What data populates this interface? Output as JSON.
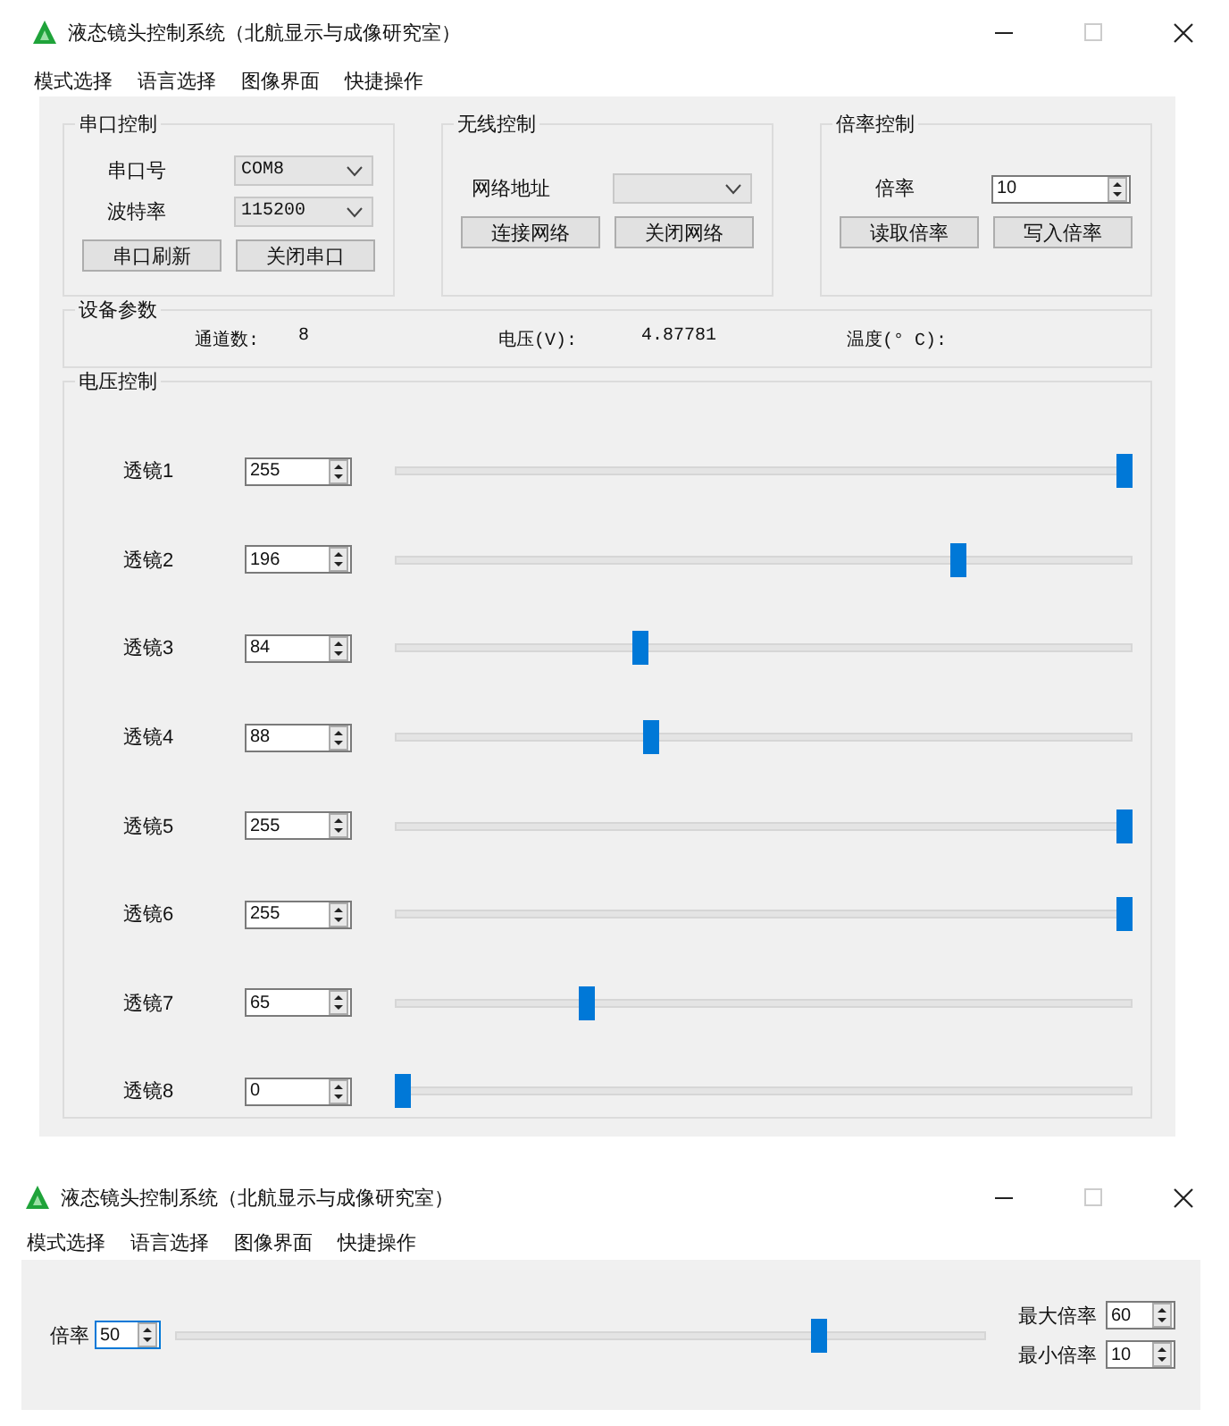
{
  "windows": [
    {
      "kind": "main",
      "title": "液态镜头控制系统（北航显示与成像研究室）",
      "menu": [
        "模式选择",
        "语言选择",
        "图像界面",
        "快捷操作"
      ],
      "serial": {
        "title": "串口控制",
        "fields": [
          {
            "label": "串口号",
            "value": "COM8"
          },
          {
            "label": "波特率",
            "value": "115200"
          }
        ],
        "buttons": [
          "串口刷新",
          "关闭串口"
        ]
      },
      "wireless": {
        "title": "无线控制",
        "label": "网络地址",
        "buttons": [
          "连接网络",
          "关闭网络"
        ]
      },
      "zoom": {
        "title": "倍率控制",
        "label": "倍率",
        "value": "10",
        "buttons": [
          "读取倍率",
          "写入倍率"
        ]
      },
      "device": {
        "title": "设备参数",
        "items": [
          {
            "label": "通道数:",
            "value": "8"
          },
          {
            "label": "电压(V):",
            "value": "4.87781"
          },
          {
            "label": "温度(° C):"
          }
        ]
      },
      "voltage": {
        "title": "电压控制",
        "lenses": [
          {
            "label": "透镜1",
            "value": "255",
            "level": 1.0
          },
          {
            "label": "透镜2",
            "value": "196",
            "level": 0.769
          },
          {
            "label": "透镜3",
            "value": "84",
            "level": 0.329
          },
          {
            "label": "透镜4",
            "value": "88",
            "level": 0.345
          },
          {
            "label": "透镜5",
            "value": "255",
            "level": 1.0
          },
          {
            "label": "透镜6",
            "value": "255",
            "level": 1.0
          },
          {
            "label": "透镜7",
            "value": "65",
            "level": 0.255
          },
          {
            "label": "透镜8",
            "value": "0",
            "level": 0.0
          }
        ]
      }
    },
    {
      "kind": "zoom",
      "title": "液态镜头控制系统（北航显示与成像研究室）",
      "menu": [
        "模式选择",
        "语言选择",
        "图像界面",
        "快捷操作"
      ],
      "zoom": {
        "label": "倍率",
        "value": "50",
        "focused": true,
        "level": 0.8
      },
      "limits": [
        {
          "label": "最大倍率",
          "value": "60"
        },
        {
          "label": "最小倍率",
          "value": "10"
        }
      ]
    }
  ]
}
